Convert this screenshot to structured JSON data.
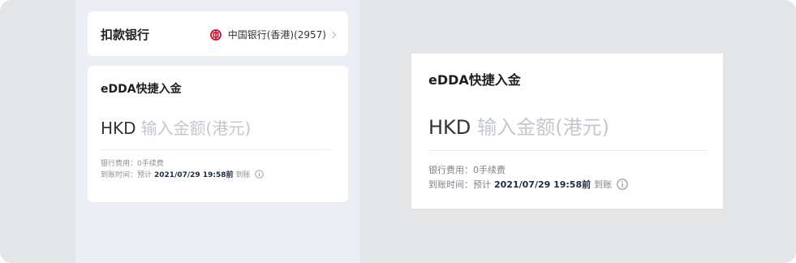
{
  "colors": {
    "background": "#e4e5e7",
    "phone_background": "#ebeef5",
    "card": "#ffffff",
    "boc_red": "#c8102e",
    "placeholder": "#c3c7cd",
    "muted_text": "#8a8f98",
    "emphasis_text": "#1f2a44"
  },
  "bank_row": {
    "label": "扣款银行",
    "icon": "boc-logo-icon",
    "value": "中国银行(香港)(2957)",
    "chevron": "chevron-right-icon"
  },
  "edda": {
    "title": "eDDA快捷入金",
    "currency": "HKD",
    "amount_placeholder": "输入金额(港元)",
    "fee_text": "银行费用：0手续费",
    "arrival_prefix": "到账时间：预计",
    "arrival_time": "2021/07/29 19:58前",
    "arrival_suffix": "到账",
    "info_icon": "info-circle-icon"
  }
}
